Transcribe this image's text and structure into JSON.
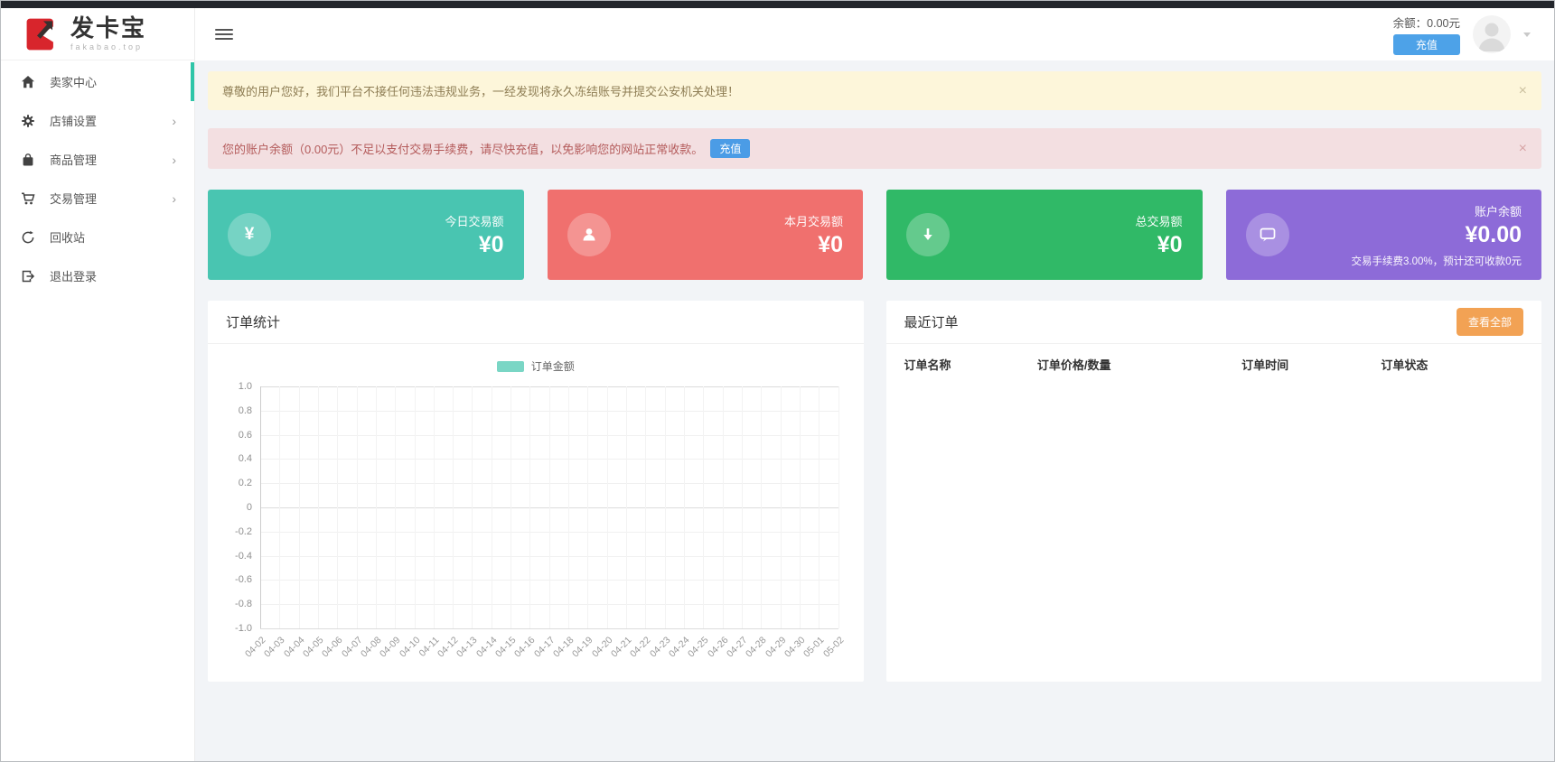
{
  "brand": {
    "name": "发卡宝",
    "domain": "fakabao.top"
  },
  "topbar": {
    "balance": "余额：0.00元",
    "recharge": "充值"
  },
  "sidebar": {
    "items": [
      {
        "label": "卖家中心",
        "icon": "home-icon",
        "active": true,
        "has_children": false
      },
      {
        "label": "店铺设置",
        "icon": "gear-icon",
        "active": false,
        "has_children": true
      },
      {
        "label": "商品管理",
        "icon": "bag-icon",
        "active": false,
        "has_children": true
      },
      {
        "label": "交易管理",
        "icon": "cart-icon",
        "active": false,
        "has_children": true
      },
      {
        "label": "回收站",
        "icon": "recycle-icon",
        "active": false,
        "has_children": false
      },
      {
        "label": "退出登录",
        "icon": "logout-icon",
        "active": false,
        "has_children": false
      }
    ]
  },
  "alerts": [
    {
      "type": "warning",
      "text": "尊敬的用户您好，我们平台不接任何违法违规业务，一经发现将永久冻结账号并提交公安机关处理！",
      "close": "×"
    },
    {
      "type": "danger",
      "text": "您的账户余额（0.00元）不足以支付交易手续费，请尽快充值，以免影响您的网站正常收款。",
      "button": "充值",
      "close": "×"
    }
  ],
  "stat_cards": [
    {
      "label": "今日交易额",
      "value": "¥0",
      "icon": "yen-icon",
      "glyph": "¥",
      "color": "#49c5b1",
      "note": ""
    },
    {
      "label": "本月交易额",
      "value": "¥0",
      "icon": "user-icon",
      "color": "#f0706e",
      "note": ""
    },
    {
      "label": "总交易额",
      "value": "¥0",
      "icon": "arrow-down-icon",
      "color": "#30b967",
      "note": ""
    },
    {
      "label": "账户余额",
      "value": "¥0.00",
      "icon": "chat-icon",
      "color": "#8d6bd8",
      "note": "交易手续费3.00%，预计还可收款0元"
    }
  ],
  "order_stats_panel": {
    "title": "订单统计"
  },
  "recent_orders_panel": {
    "title": "最近订单",
    "view_all": "查看全部",
    "columns": [
      "订单名称",
      "订单价格/数量",
      "订单时间",
      "订单状态"
    ],
    "rows": []
  },
  "chart_data": {
    "type": "line",
    "title": "订单统计",
    "categories": [
      "04-02",
      "04-03",
      "04-04",
      "04-05",
      "04-06",
      "04-07",
      "04-08",
      "04-09",
      "04-10",
      "04-11",
      "04-12",
      "04-13",
      "04-14",
      "04-15",
      "04-16",
      "04-17",
      "04-18",
      "04-19",
      "04-20",
      "04-21",
      "04-22",
      "04-23",
      "04-24",
      "04-25",
      "04-26",
      "04-27",
      "04-28",
      "04-29",
      "04-30",
      "05-01",
      "05-02"
    ],
    "series": [
      {
        "name": "订单金额",
        "color": "#7ad6c5",
        "values": []
      }
    ],
    "ylim": [
      -1,
      1
    ],
    "y_ticks": [
      "1.0",
      "0.8",
      "0.6",
      "0.4",
      "0.2",
      "0",
      "-0.2",
      "-0.4",
      "-0.6",
      "-0.8",
      "-1.0"
    ],
    "grid": true,
    "legend_position": "top"
  }
}
